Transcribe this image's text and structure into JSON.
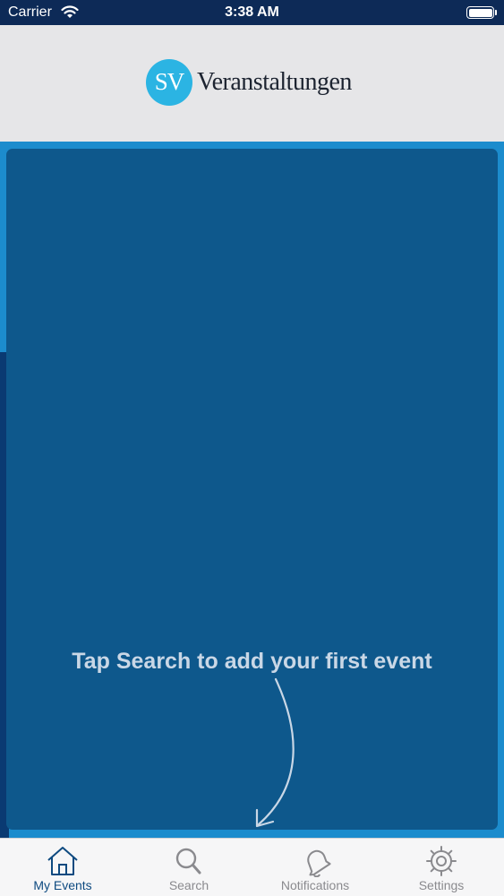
{
  "status_bar": {
    "carrier": "Carrier",
    "time": "3:38 AM"
  },
  "header": {
    "logo_initials": "SV",
    "logo_text": "Veranstaltungen"
  },
  "main": {
    "hint_text": "Tap Search to add your first event"
  },
  "tabs": [
    {
      "label": "My Events",
      "icon": "home-icon",
      "active": true
    },
    {
      "label": "Search",
      "icon": "search-icon",
      "active": false
    },
    {
      "label": "Notifications",
      "icon": "bell-icon",
      "active": false
    },
    {
      "label": "Settings",
      "icon": "gear-icon",
      "active": false
    }
  ],
  "colors": {
    "status_bar": "#0d2a57",
    "header_bg": "#e6e6e8",
    "logo_accent": "#2bb4e3",
    "main_bg": "#1c8ccd",
    "card_bg": "#0e588c",
    "active_tab": "#0e4a80",
    "inactive_tab": "#8a8a8e"
  }
}
